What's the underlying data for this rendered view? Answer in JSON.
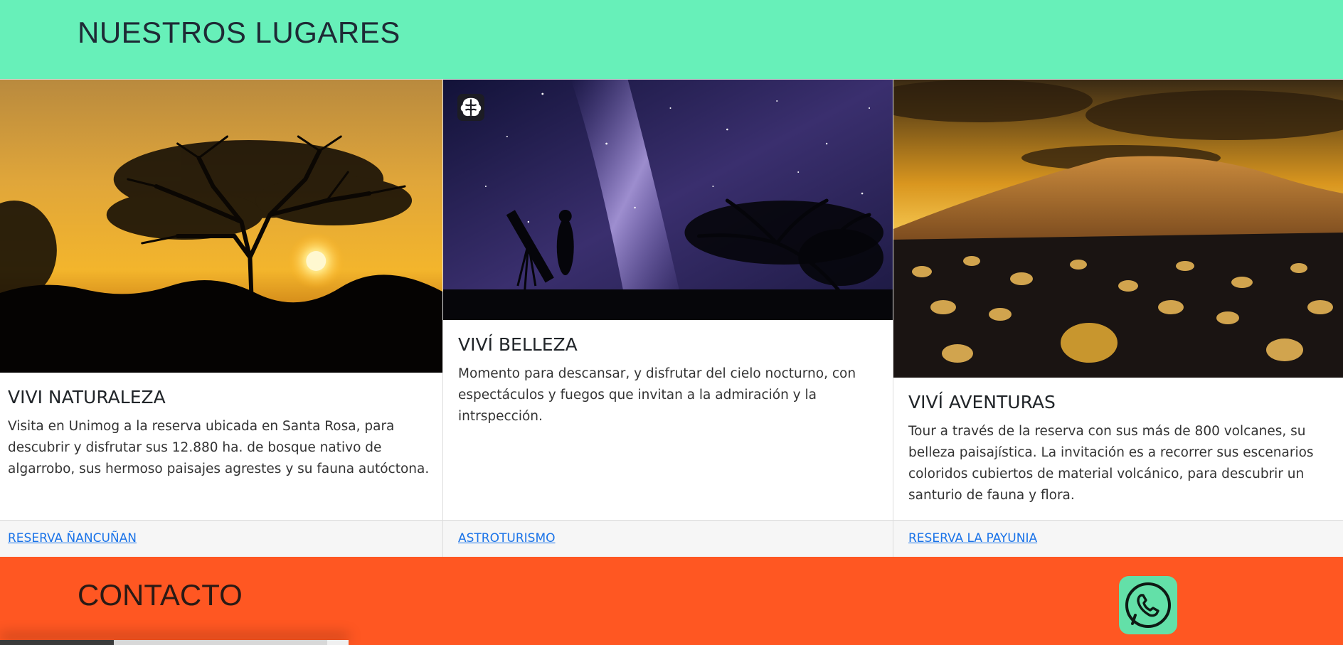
{
  "header": {
    "title": "NUESTROS LUGARES"
  },
  "cards": [
    {
      "title": "VIVI NATURALEZA",
      "text": "Visita en Unimog a la reserva ubicada en Santa Rosa, para descubrir y disfrutar sus 12.880 ha. de bosque nativo de algarrobo, sus hermoso paisajes agrestes y su fauna autóctona.",
      "link": "RESERVA ÑANCUÑAN",
      "image_icon": "sunset-tree-image"
    },
    {
      "title": "VIVÍ BELLEZA",
      "text": "Momento para descansar, y disfrutar del cielo nocturno, con espectáculos y fuegos que invitan a la admiración y la intrspección.",
      "link": "ASTROTURISMO",
      "image_icon": "night-sky-telescope-image",
      "badge_icon": "brain-icon"
    },
    {
      "title": "VIVÍ AVENTURAS",
      "text": "Tour a través de la reserva con sus más de 800 volcanes, su belleza paisajística. La invitación es a recorrer sus escenarios coloridos cubiertos de material volcánico, para descubrir un santurio de fauna y flora.",
      "link": "RESERVA LA PAYUNIA",
      "image_icon": "volcanic-landscape-image"
    }
  ],
  "contact": {
    "title": "CONTACTO",
    "whatsapp_icon": "whatsapp-icon"
  },
  "colors": {
    "header_bg": "#67f0b9",
    "contact_bg": "#ff5722",
    "link": "#1a73e8",
    "whatsapp_bg": "#63e0a8"
  }
}
